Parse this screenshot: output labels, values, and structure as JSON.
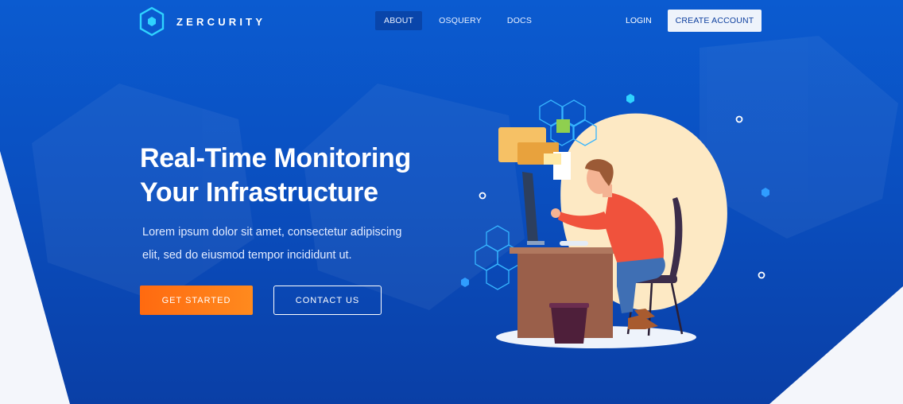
{
  "brand": {
    "name": "ZERCURITY",
    "logo_icon": "hexagon-logo-icon"
  },
  "nav": {
    "items": [
      {
        "label": "ABOUT",
        "active": true
      },
      {
        "label": "OSQUERY",
        "active": false
      },
      {
        "label": "DOCS",
        "active": false
      }
    ],
    "login_label": "LOGIN",
    "create_account_label": "CREATE ACCOUNT"
  },
  "hero": {
    "title_line1": "Real-Time Monitoring",
    "title_line2": "Your Infrastructure",
    "lead_line1": "Lorem ipsum dolor sit amet, consectetur adipiscing",
    "lead_line2": "elit, sed do eiusmod tempor incididunt ut.",
    "primary_cta": "GET STARTED",
    "secondary_cta": "CONTACT US"
  },
  "colors": {
    "background": "#0a4fc0",
    "accent_orange": "#ff6a10",
    "accent_cyan": "#2fd3ff",
    "blob": "#fde9c4"
  }
}
